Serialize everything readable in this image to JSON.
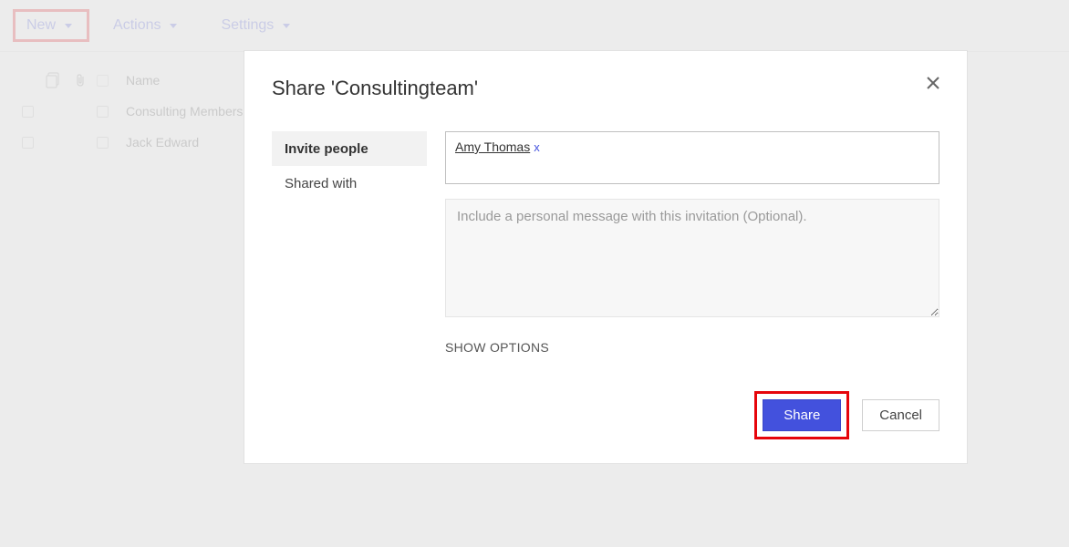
{
  "toolbar": {
    "new_label": "New",
    "actions_label": "Actions",
    "settings_label": "Settings"
  },
  "columns": {
    "name": "Name"
  },
  "items": [
    {
      "name": "Consulting Members"
    },
    {
      "name": "Jack Edward"
    }
  ],
  "dialog": {
    "title": "Share 'Consultingteam'",
    "tabs": {
      "invite": "Invite people",
      "shared_with": "Shared with"
    },
    "people": [
      {
        "name": "Amy Thomas"
      }
    ],
    "remove_token": "x",
    "message_placeholder": "Include a personal message with this invitation (Optional).",
    "message_value": "",
    "show_options_label": "SHOW OPTIONS",
    "share_label": "Share",
    "cancel_label": "Cancel"
  }
}
